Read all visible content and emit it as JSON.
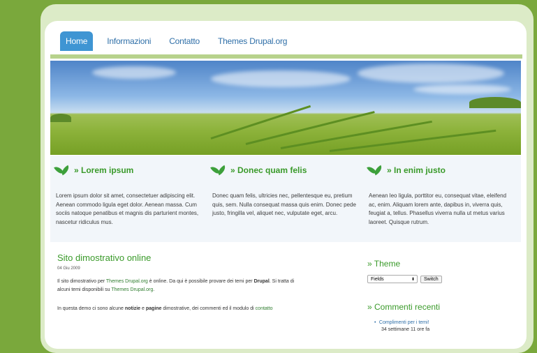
{
  "nav": {
    "items": [
      "Home",
      "Informazioni",
      "Contatto",
      "Themes Drupal.org"
    ],
    "active": "Home"
  },
  "features": [
    {
      "title": "» Lorem ipsum",
      "text": "Lorem ipsum dolor sit amet, consectetuer adipiscing elit. Aenean commodo ligula eget dolor. Aenean massa. Cum sociis natoque penatibus et magnis dis parturient montes, nascetur ridiculus mus."
    },
    {
      "title": "» Donec quam felis",
      "text": "Donec quam felis, ultricies nec, pellentesque eu, pretium quis, sem. Nulla consequat massa quis enim. Donec pede justo, fringilla vel, aliquet nec, vulputate eget, arcu."
    },
    {
      "title": "» In enim justo",
      "text": "Aenean leo ligula, porttitor eu, consequat vitae, eleifend ac, enim. Aliquam lorem ante, dapibus in, viverra quis, feugiat a, tellus. Phasellus viverra nulla ut metus varius laoreet. Quisque rutrum."
    }
  ],
  "article": {
    "title": "Sito dimostrativo online",
    "date": "04 Giu 2009",
    "p1_a": "Il sito dimostrativo per ",
    "p1_link": "Themes Drupal.org",
    "p1_b": " è online. Da qui è possibile provare dei temi per ",
    "p1_bold": "Drupal",
    "p1_c": ". Si tratta di",
    "p1_d": "alcuni temi disponibili su ",
    "p1_link2": "Themes Drupal.org",
    "p1_e": ".",
    "p2_a": "In questa demo ci sono alcune ",
    "p2_bold1": "notizie",
    "p2_b": " e ",
    "p2_bold2": "pagine",
    "p2_c": " dimostrative, dei commenti ed il modulo di ",
    "p2_link": "contatto"
  },
  "sidebar": {
    "theme_title": "» Theme",
    "theme_select": "Fields",
    "switch_label": "Switch",
    "comments_title": "» Commenti recenti",
    "comment_link": "Complimenti per i temi!",
    "comment_meta": "34 settimane 11 ore fa"
  }
}
